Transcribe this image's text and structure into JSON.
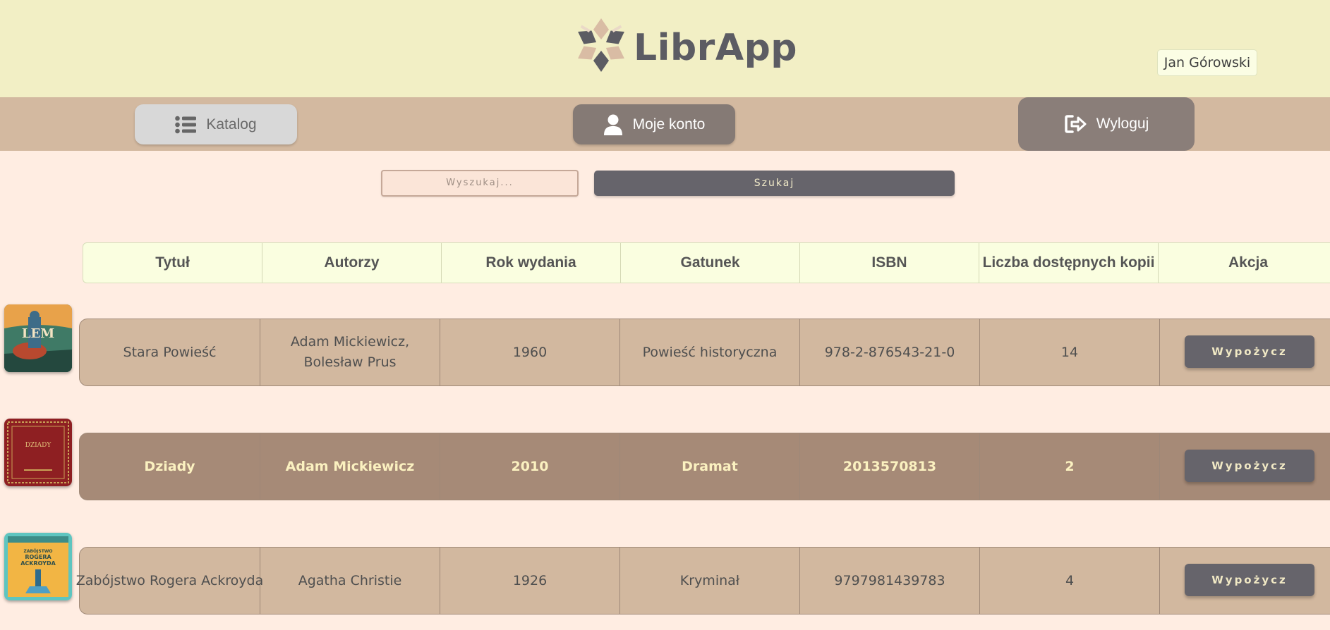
{
  "app": {
    "name": "LibrApp"
  },
  "user": {
    "name": "Jan Górowski"
  },
  "nav": {
    "katalog": "Katalog",
    "konto": "Moje konto",
    "wyloguj": "Wyloguj"
  },
  "search": {
    "placeholder": "Wyszukaj...",
    "button": "Szukaj"
  },
  "table": {
    "headers": [
      "Tytuł",
      "Autorzy",
      "Rok wydania",
      "Gatunek",
      "ISBN",
      "Liczba dostępnych kopii",
      "Akcja"
    ],
    "rows": [
      {
        "title": "Stara Powieść",
        "authors": "Adam Mickiewicz, Bolesław Prus",
        "year": "1960",
        "genre": "Powieść historyczna",
        "isbn": "978-2-876543-21-0",
        "copies": "14",
        "action": "Wypożycz",
        "cover_text": "LEM"
      },
      {
        "title": "Dziady",
        "authors": "Adam Mickiewicz",
        "year": "2010",
        "genre": "Dramat",
        "isbn": "2013570813",
        "copies": "2",
        "action": "Wypożycz",
        "cover_text": "DZIADY"
      },
      {
        "title": "Zabójstwo Rogera Ackroyda",
        "authors": "Agatha Christie",
        "year": "1926",
        "genre": "Kryminał",
        "isbn": "9797981439783",
        "copies": "4",
        "action": "Wypożycz",
        "cover_text": "ZABÓJSTWO ROGERA ACKROYDA"
      }
    ]
  },
  "colors": {
    "header_bg": "#F2EFC5",
    "nav_bg": "#D3B9A0",
    "page_bg": "#FFEDE2",
    "button_dark": "#66646B",
    "row_light": "#D2B89F",
    "row_dark": "#A68A77"
  }
}
